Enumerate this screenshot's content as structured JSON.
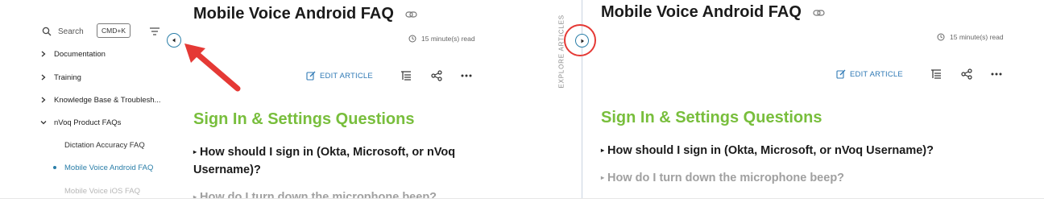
{
  "left": {
    "sidebar": {
      "search_label": "Search",
      "shortcut": "CMD+K",
      "items": [
        {
          "label": "Documentation"
        },
        {
          "label": "Training"
        },
        {
          "label": "Knowledge Base & Troublesh..."
        },
        {
          "label": "nVoq Product FAQs"
        }
      ],
      "sub_items": [
        {
          "label": "Dictation Accuracy FAQ"
        },
        {
          "label": "Mobile Voice Android FAQ",
          "active": true
        },
        {
          "label": "Mobile Voice iOS FAQ"
        }
      ],
      "collapse_icon": "chevron-left-icon"
    },
    "article": {
      "title": "Mobile Voice Android FAQ",
      "read_time": "15 minute(s) read",
      "edit_label": "EDIT ARTICLE",
      "section_heading": "Sign In & Settings Questions",
      "questions": [
        "How should I sign in (Okta, Microsoft, or nVoq Username)?",
        "How do I turn down the microphone beep?"
      ]
    },
    "annotation_color": "#e53935"
  },
  "right": {
    "explore_label": "EXPLORE ARTICLES",
    "expand_icon": "chevron-right-icon",
    "article": {
      "title": "Mobile Voice Android FAQ",
      "read_time": "15 minute(s) read",
      "edit_label": "EDIT ARTICLE",
      "section_heading": "Sign In & Settings Questions",
      "questions": [
        "How should I sign in (Okta, Microsoft, or nVoq Username)?",
        "How do I turn down the microphone beep?"
      ]
    }
  },
  "colors": {
    "accent": "#2a7ea8",
    "heading_green": "#78be3c",
    "link_blue": "#2f79b5",
    "annotation_red": "#e53935"
  }
}
